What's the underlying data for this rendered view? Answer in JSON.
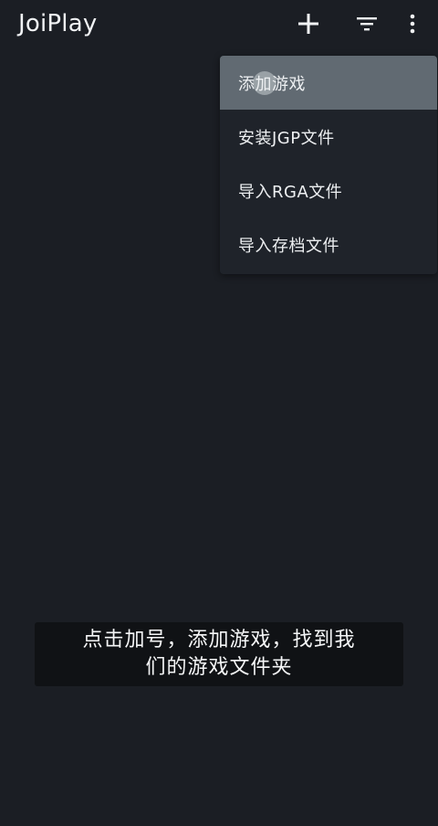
{
  "app": {
    "title": "JoiPlay"
  },
  "toolbar": {
    "icons": [
      "add-icon",
      "filter-icon",
      "more-vert-icon"
    ]
  },
  "menu": {
    "items": [
      {
        "label": "添加游戏",
        "highlighted": true
      },
      {
        "label": "安装JGP文件",
        "highlighted": false
      },
      {
        "label": "导入RGA文件",
        "highlighted": false
      },
      {
        "label": "导入存档文件",
        "highlighted": false
      }
    ]
  },
  "caption": {
    "line1": "点击加号，添加游戏，找到我",
    "line2": "们的游戏文件夹"
  },
  "colors": {
    "background": "#1b1e24",
    "menu_background": "#1f232a",
    "menu_highlight": "#616a72",
    "caption_background": "#101215",
    "text": "#eef0f2"
  }
}
